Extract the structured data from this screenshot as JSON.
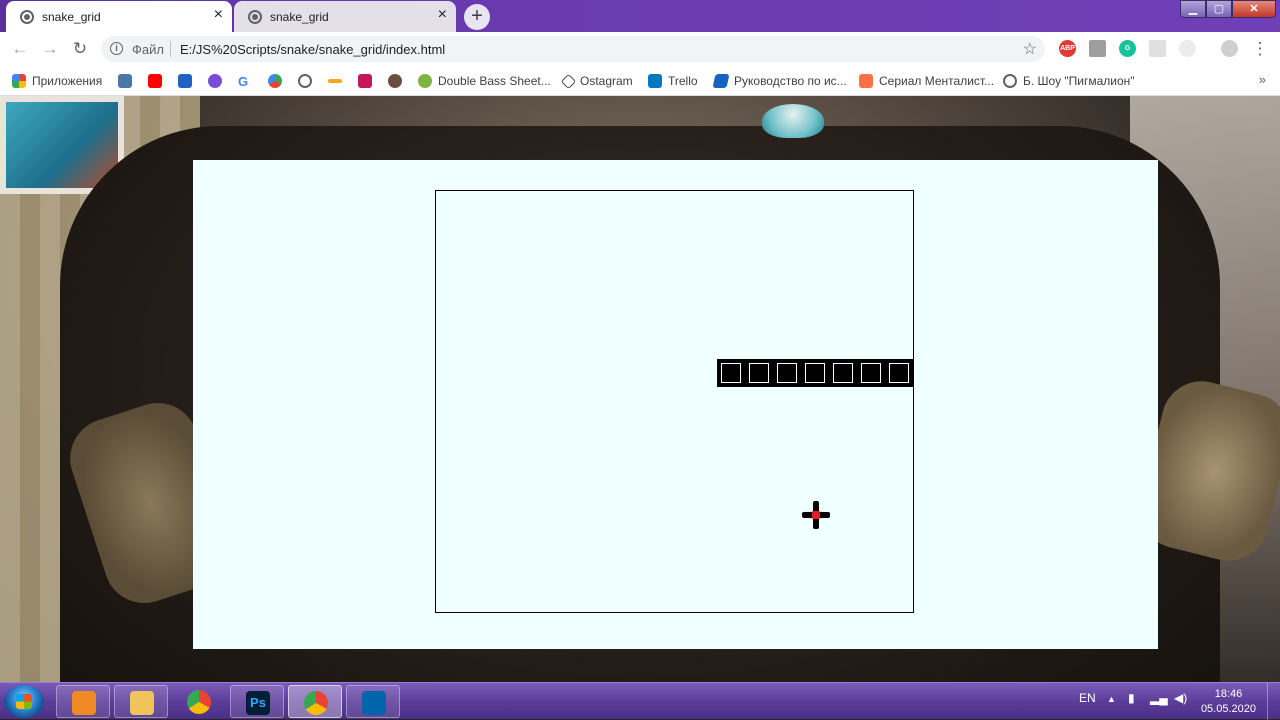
{
  "browser": {
    "tabs": [
      {
        "title": "snake_grid",
        "active": true
      },
      {
        "title": "snake_grid",
        "active": false
      }
    ],
    "new_tab_label": "+",
    "close_glyph": "×",
    "omnibox": {
      "info_glyph": "i",
      "scheme_label": "Файл",
      "url": "E:/JS%20Scripts/snake/snake_grid/index.html",
      "star_glyph": "☆"
    },
    "nav": {
      "back": "←",
      "forward": "→",
      "reload": "↻"
    },
    "extensions": [
      "ABP",
      "pdf",
      "grammarly",
      "ext",
      "ext",
      "profile"
    ],
    "bookmarks": [
      {
        "label": "Приложения",
        "icon": "apps-icon"
      },
      {
        "label": "",
        "icon": "vk-icon"
      },
      {
        "label": "",
        "icon": "youtube-icon"
      },
      {
        "label": "",
        "icon": "mail-icon"
      },
      {
        "label": "",
        "icon": "bookmark-icon"
      },
      {
        "label": "G",
        "icon": "google-icon"
      },
      {
        "label": "",
        "icon": "bookmark-icon"
      },
      {
        "label": "",
        "icon": "globe-icon"
      },
      {
        "label": "",
        "icon": "bookmark-icon"
      },
      {
        "label": "",
        "icon": "bookmark-icon"
      },
      {
        "label": "",
        "icon": "bookmark-icon"
      },
      {
        "label": "Double Bass Sheet...",
        "icon": "bookmark-icon"
      },
      {
        "label": "Ostagram",
        "icon": "ostagram-icon"
      },
      {
        "label": "Trello",
        "icon": "trello-icon"
      },
      {
        "label": "Руководство по ис...",
        "icon": "bookmark-icon"
      },
      {
        "label": "Сериал Менталист...",
        "icon": "bookmark-icon"
      },
      {
        "label": "Б. Шоу \"Пигмалион\"",
        "icon": "globe-icon"
      }
    ],
    "bookmarks_more": "»"
  },
  "game": {
    "snake_length_cells": 7
  },
  "taskbar": {
    "apps": [
      "windows-start",
      "media-player",
      "file-explorer",
      "chrome",
      "photoshop",
      "chrome-active",
      "vscode"
    ],
    "photoshop_label": "Ps",
    "language": "EN",
    "time": "18:46",
    "date": "05.05.2020"
  }
}
